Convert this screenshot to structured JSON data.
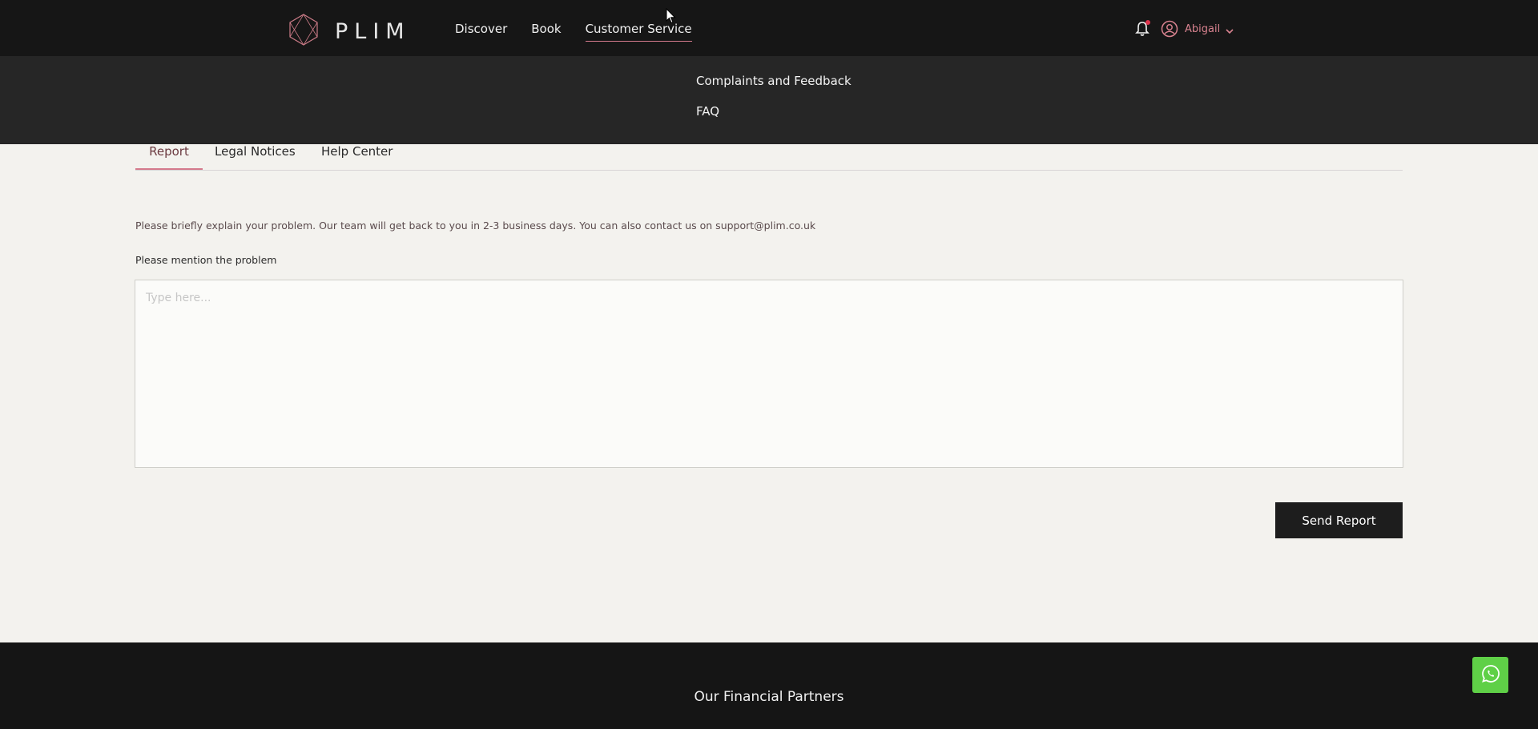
{
  "brand": {
    "name": "PLIM"
  },
  "nav": {
    "items": [
      {
        "label": "Discover"
      },
      {
        "label": "Book"
      },
      {
        "label": "Customer Service",
        "active": true
      }
    ]
  },
  "user": {
    "name": "Abigail",
    "notification_dot_color": "#e0344d"
  },
  "submenu": {
    "items": [
      {
        "label": "Complaints and Feedback"
      },
      {
        "label": "FAQ"
      }
    ]
  },
  "tabs": [
    {
      "label": "Report",
      "active": true
    },
    {
      "label": "Legal Notices"
    },
    {
      "label": "Help Center"
    }
  ],
  "report": {
    "info_text": "Please briefly explain your problem. Our team will get back to you in 2-3 business days. You can also contact us on support@plim.co.uk",
    "field_label": "Please mention the problem",
    "placeholder": "Type here...",
    "value": "",
    "send_label": "Send Report"
  },
  "footer": {
    "title": "Our Financial Partners"
  },
  "colors": {
    "accent": "#d47a8c",
    "header_bg": "#161616",
    "submenu_bg": "#262626",
    "button_bg": "#1d1d1d",
    "whatsapp": "#5fd047"
  }
}
